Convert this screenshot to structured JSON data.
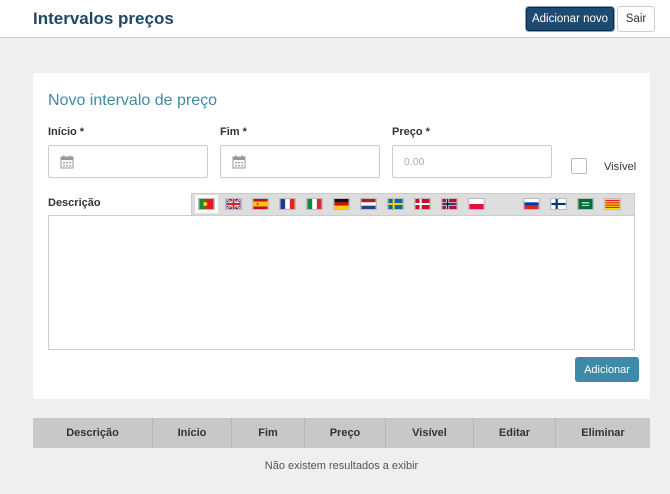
{
  "header": {
    "title": "Intervalos preços",
    "add_new_label": "Adicionar novo",
    "exit_label": "Sair"
  },
  "form": {
    "title": "Novo intervalo de preço",
    "start_label": "Início *",
    "end_label": "Fim *",
    "price_label": "Preço *",
    "price_placeholder": "0.00",
    "visible_label": "Visível",
    "visible_checked": false,
    "description_label": "Descrição",
    "description_value": "",
    "languages": [
      {
        "icon": "flag-portugal-icon",
        "active": true
      },
      {
        "icon": "flag-uk-icon",
        "active": false
      },
      {
        "icon": "flag-spain-icon",
        "active": false
      },
      {
        "icon": "flag-france-icon",
        "active": false
      },
      {
        "icon": "flag-italy-icon",
        "active": false
      },
      {
        "icon": "flag-germany-icon",
        "active": false
      },
      {
        "icon": "flag-netherlands-icon",
        "active": false
      },
      {
        "icon": "flag-sweden-icon",
        "active": false
      },
      {
        "icon": "flag-denmark-icon",
        "active": false
      },
      {
        "icon": "flag-norway-icon",
        "active": false
      },
      {
        "icon": "flag-poland-icon",
        "active": false
      },
      {
        "icon": "flag-russia-icon",
        "active": false
      },
      {
        "icon": "flag-finland-icon",
        "active": false
      },
      {
        "icon": "flag-saudi-arabia-icon",
        "active": false
      },
      {
        "icon": "flag-catalonia-icon",
        "active": false
      }
    ],
    "add_label": "Adicionar"
  },
  "table": {
    "columns": [
      "Descrição",
      "Início",
      "Fim",
      "Preço",
      "Visível",
      "Editar",
      "Eliminar"
    ],
    "empty_message": "Não existem resultados a exibir"
  },
  "colors": {
    "primary": "#1e4a70",
    "accent": "#3d8ba6",
    "background": "#efefef"
  }
}
